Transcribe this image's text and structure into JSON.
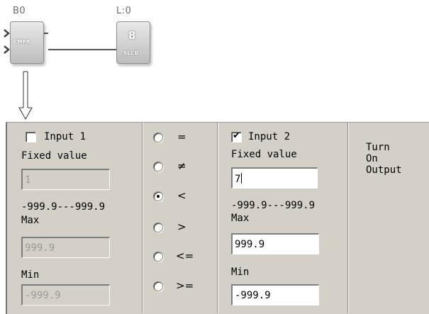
{
  "diagram": {
    "block1": {
      "label": "B0",
      "text": "CMPR"
    },
    "block2": {
      "label": "L:0",
      "digit": "8",
      "text": "SLCD"
    }
  },
  "input1": {
    "checkbox_label": "Input 1",
    "checked": false,
    "fixed_value_label": "Fixed value",
    "value": "1",
    "range": "-999.9---999.9",
    "max_label": "Max",
    "max_value": "999.9",
    "min_label": "Min",
    "min_value": "-999.9"
  },
  "operators": [
    {
      "symbol": "=",
      "selected": false
    },
    {
      "symbol": "≠",
      "selected": false
    },
    {
      "symbol": "<",
      "selected": true
    },
    {
      "symbol": ">",
      "selected": false
    },
    {
      "symbol": "<=",
      "selected": false
    },
    {
      "symbol": ">=",
      "selected": false
    }
  ],
  "input2": {
    "checkbox_label": "Input 2",
    "checked": true,
    "fixed_value_label": "Fixed value",
    "value": "7",
    "range": "-999.9---999.9",
    "max_label": "Max",
    "max_value": "999.9",
    "min_label": "Min",
    "min_value": "-999.9"
  },
  "output": {
    "line1": "Turn",
    "line2": "On",
    "line3": "Output"
  },
  "colors": {
    "panel": "#d4d0c8",
    "disabled_text": "#9a9a9a",
    "block_label": "#6b6b6b"
  }
}
